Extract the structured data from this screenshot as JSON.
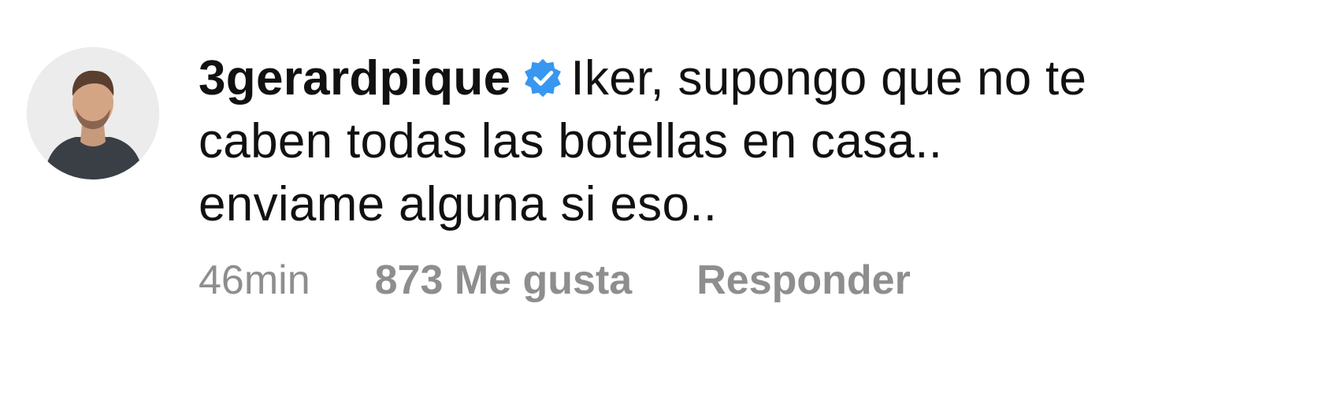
{
  "comment": {
    "username": "3gerardpique",
    "verified_icon": "verified-badge-icon",
    "verified_color": "#3897f0",
    "text_line_1": "Iker, supongo que no te",
    "text_line_2": "caben todas las botellas en casa..",
    "text_line_3": "enviame alguna si eso..",
    "time": "46min",
    "likes_label": "873 Me gusta",
    "reply_label": "Responder"
  },
  "colors": {
    "text": "#111111",
    "meta": "#8e8e8e",
    "background": "#ffffff"
  }
}
